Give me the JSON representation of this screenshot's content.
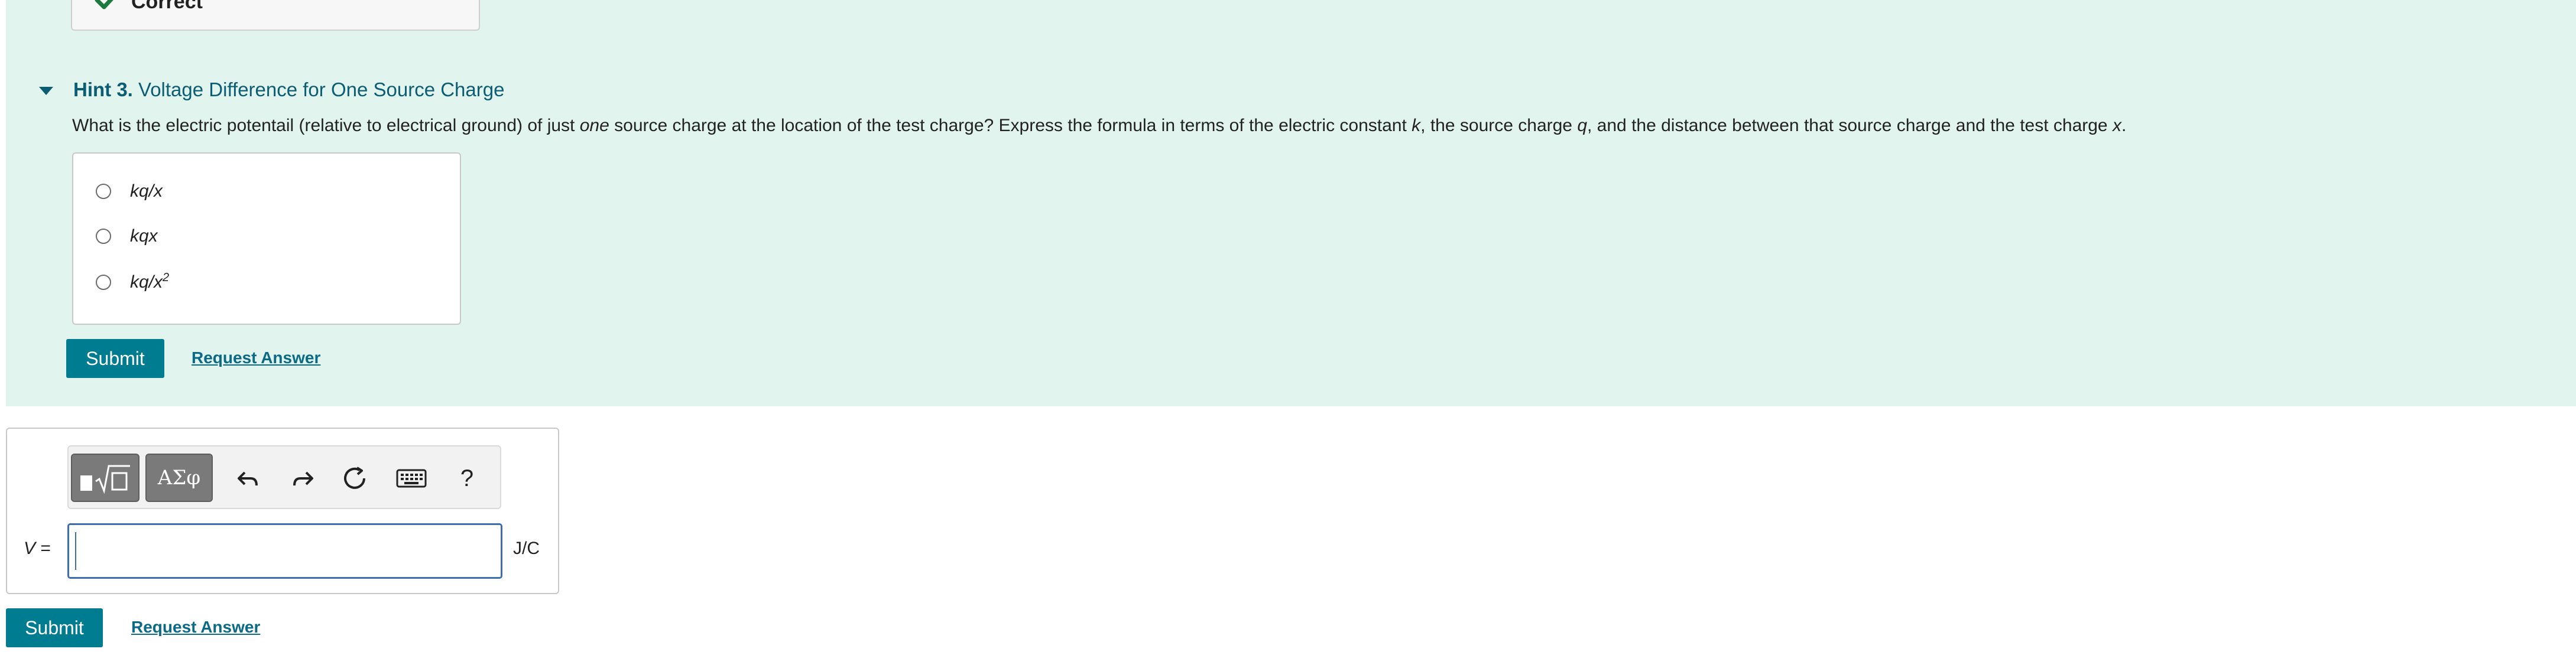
{
  "feedback": {
    "correct_label": "Correct"
  },
  "hint": {
    "number_label": "Hint 3.",
    "title": "Voltage Difference for One Source Charge",
    "question_parts": [
      "What is the electric potentail (relative to electrical ground) of just ",
      "one",
      " source charge at the location of the test charge? Express the formula in terms of the electric constant ",
      "k",
      ", the source charge ",
      "q",
      ", and the distance between that source charge and the test charge ",
      "x",
      "."
    ],
    "options": [
      {
        "label": "kq/x"
      },
      {
        "label": "kqx"
      },
      {
        "label_base": "kq/x",
        "label_sup": "2"
      }
    ],
    "submit_label": "Submit",
    "request_answer_label": "Request Answer"
  },
  "answer": {
    "toolbar": {
      "templates_icon": "fraction-sqrt-icon",
      "greek_label": "ΑΣφ",
      "undo_icon": "undo-icon",
      "redo_icon": "redo-icon",
      "reset_icon": "reset-icon",
      "keyboard_icon": "keyboard-icon",
      "help_label": "?"
    },
    "variable": "V",
    "equals": " =",
    "unit": "J/C",
    "input_value": "",
    "submit_label": "Submit",
    "request_answer_label": "Request Answer"
  },
  "colors": {
    "hint_background": "#e1f4ed",
    "accent": "#007c91",
    "link": "#0b6a86",
    "title": "#0b5d74",
    "check": "#1d7a3f"
  }
}
